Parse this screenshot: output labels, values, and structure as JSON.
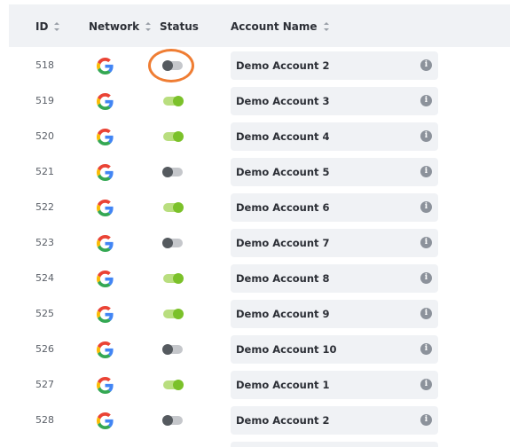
{
  "columns": {
    "id": "ID",
    "network": "Network",
    "status": "Status",
    "account_name": "Account Name"
  },
  "rows": [
    {
      "id": "518",
      "status": "off",
      "account": "Demo Account 2"
    },
    {
      "id": "519",
      "status": "on",
      "account": "Demo Account 3"
    },
    {
      "id": "520",
      "status": "on",
      "account": "Demo Account 4"
    },
    {
      "id": "521",
      "status": "off",
      "account": "Demo Account 5"
    },
    {
      "id": "522",
      "status": "on",
      "account": "Demo Account 6"
    },
    {
      "id": "523",
      "status": "off",
      "account": "Demo Account 7"
    },
    {
      "id": "524",
      "status": "on",
      "account": "Demo Account 8"
    },
    {
      "id": "525",
      "status": "on",
      "account": "Demo Account 9"
    },
    {
      "id": "526",
      "status": "off",
      "account": "Demo Account 10"
    },
    {
      "id": "527",
      "status": "on",
      "account": "Demo Account 1"
    },
    {
      "id": "528",
      "status": "off",
      "account": "Demo Account 2"
    }
  ],
  "icons": {
    "network": "google-icon",
    "info": "info-icon",
    "sort": "sort-icon"
  },
  "colors": {
    "toggle_on": "#7bc12a",
    "toggle_off": "#555a5f",
    "highlight": "#ef7d33",
    "header_bg": "#f0f2f5"
  }
}
